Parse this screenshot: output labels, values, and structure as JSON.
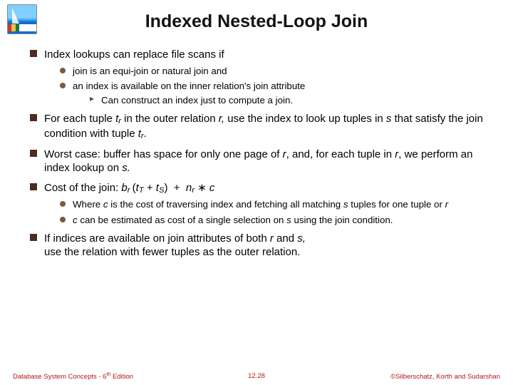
{
  "title": "Indexed Nested-Loop Join",
  "b1": "Index lookups can replace file scans if",
  "b1a": "join is an equi-join or natural join and",
  "b1b": "an index is available on the inner relation's join attribute",
  "b1b1": "Can construct an index just to compute a join.",
  "b2_pre": "For each tuple ",
  "b2_mid1": " in the outer relation ",
  "b2_mid2": " use the index to look up tuples in ",
  "b2_mid3": " that satisfy the join condition with tuple ",
  "b3_pre": "Worst case:  buffer has space for only one page of ",
  "b3_mid": ", and, for each tuple in ",
  "b3_post": ", we perform an index lookup on ",
  "b4_pre": "Cost of the join:  ",
  "b4a_pre": "Where ",
  "b4a_mid": " is the cost of traversing index and fetching all matching ",
  "b4a_post": " tuples for one tuple or ",
  "b4b_pre": "",
  "b4b_text": " can be estimated as cost of a single selection on ",
  "b4b_post": " using the join condition.",
  "b5_pre": "If indices are available on join attributes of both ",
  "b5_mid": " and ",
  "b5_post": " use the relation with fewer tuples as the outer relation.",
  "footer_left_pre": "Database System Concepts - 6",
  "footer_left_post": " Edition",
  "footer_center": "12.28",
  "footer_right": "©Silberschatz, Korth and Sudarshan",
  "chart_data": null
}
